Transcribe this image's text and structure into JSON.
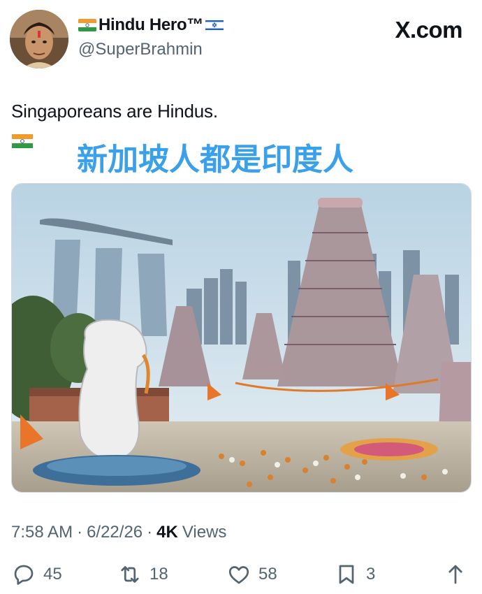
{
  "tweet": {
    "display_name": "Hindu Hero™",
    "handle": "@SuperBrahmin",
    "brand": "X.com",
    "text": "Singaporeans are Hindus.",
    "overlay_caption": "新加坡人都是印度人",
    "timestamp": "7:58 AM",
    "date": "6/22/26",
    "views_count": "4K",
    "views_label": "Views",
    "separator": "·"
  },
  "actions": {
    "replies": "45",
    "reposts": "18",
    "likes": "58",
    "bookmarks": "3"
  },
  "colors": {
    "accent_caption": "#3aa0ea",
    "secondary_text": "#536471",
    "primary_text": "#0f1419"
  }
}
